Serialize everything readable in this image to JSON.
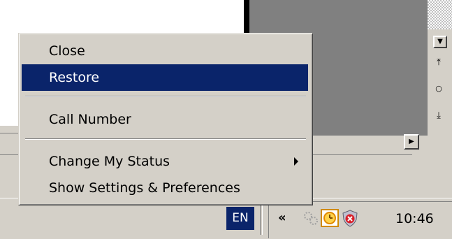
{
  "menu": {
    "items": [
      {
        "label": "Close",
        "highlighted": false
      },
      {
        "label": "Restore",
        "highlighted": true
      },
      {
        "label": "Call Number",
        "highlighted": false
      },
      {
        "label": "Change My Status",
        "highlighted": false,
        "has_submenu": true
      },
      {
        "label": "Show Settings & Preferences",
        "highlighted": false
      }
    ]
  },
  "taskbar": {
    "language": "EN",
    "tray_expand": "«",
    "clock": "10:46",
    "tray_icons": [
      "network-activity-icon",
      "clock-status-icon",
      "security-shield-icon"
    ]
  },
  "scrollbar": {
    "down_arrow": "▼",
    "right_arrow": "▶",
    "page_up": "⤒",
    "page_down": "⤓",
    "select_browse": "○"
  },
  "colors": {
    "highlight": "#0a246a",
    "face": "#d4d0c8",
    "shadow": "#808080",
    "panel": "#808080"
  }
}
